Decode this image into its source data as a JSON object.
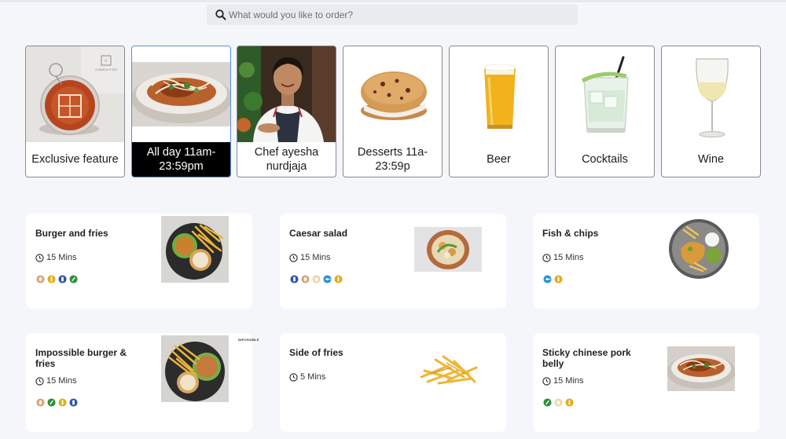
{
  "search": {
    "placeholder": "What would you like to order?"
  },
  "categories": [
    {
      "label": "Exclusive feature",
      "active": false,
      "image_text": "CONNAUGHT BAR"
    },
    {
      "label": "All day 11am-23:59pm",
      "active": true
    },
    {
      "label": "Chef ayesha nurdjaja",
      "active": false
    },
    {
      "label": "Desserts 11a-23:59p",
      "active": false
    },
    {
      "label": "Beer",
      "active": false
    },
    {
      "label": "Cocktails",
      "active": false
    },
    {
      "label": "Wine",
      "active": false
    }
  ],
  "items": [
    {
      "name": "Burger and fries",
      "time": "15 Mins",
      "tags": [
        "peanut",
        "wheat",
        "milk",
        "celery"
      ]
    },
    {
      "name": "Caesar salad",
      "time": "15 Mins",
      "tags": [
        "milk",
        "peanut",
        "egg",
        "fish",
        "wheat"
      ]
    },
    {
      "name": "Fish & chips",
      "time": "15 Mins",
      "tags": [
        "fish",
        "wheat"
      ]
    },
    {
      "name": "Impossible burger & fries",
      "time": "15 Mins",
      "tags": [
        "peanut",
        "celery",
        "wheat",
        "milk"
      ],
      "image_text": "IMPOSSIBLE"
    },
    {
      "name": "Side of fries",
      "time": "5 Mins",
      "tags": []
    },
    {
      "name": "Sticky chinese pork belly",
      "time": "15 Mins",
      "tags": [
        "celery",
        "egg",
        "wheat"
      ]
    }
  ],
  "tag_colors": {
    "peanut": "#d7a37a",
    "wheat": "#e3ac18",
    "milk": "#2f56a6",
    "celery": "#2f8f3a",
    "egg": "#f0d7a5",
    "fish": "#2a93d6"
  },
  "colors": {
    "active_border": "#5a8fd6",
    "active_bg": "#000000",
    "page_bg": "#f4f6fa"
  }
}
